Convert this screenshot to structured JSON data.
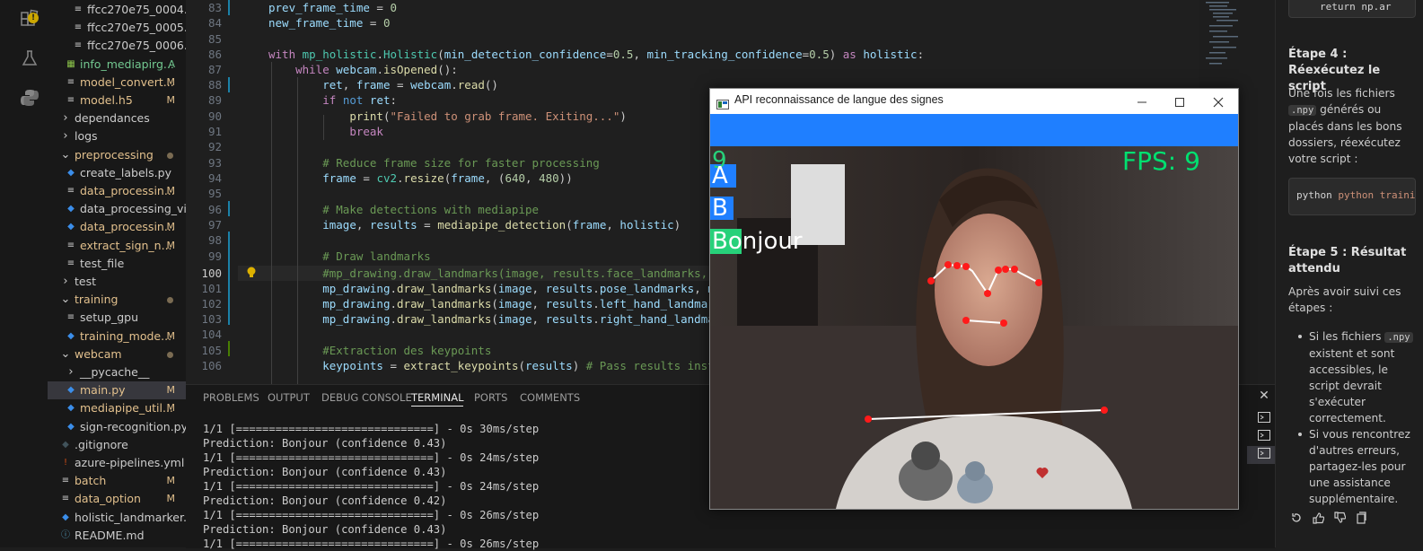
{
  "activity_bar": {
    "icons": [
      "extensions-icon",
      "flask-icon",
      "python-icon"
    ],
    "warning_badge": "!"
  },
  "explorer": {
    "rows": [
      {
        "label": "ffcc270e75_0004.n...",
        "status": "",
        "icon": "file-lines-icon",
        "indent": 2
      },
      {
        "label": "ffcc270e75_0005.n...",
        "status": "",
        "icon": "file-lines-icon",
        "indent": 2
      },
      {
        "label": "ffcc270e75_0006.n...",
        "status": "",
        "icon": "file-lines-icon",
        "indent": 2
      },
      {
        "label": "info_mediapirg...",
        "status": "A",
        "icon": "table-icon",
        "indent": 1
      },
      {
        "label": "model_convert...",
        "status": "M",
        "icon": "file-lines-icon",
        "indent": 1
      },
      {
        "label": "model.h5",
        "status": "M",
        "icon": "file-lines-icon",
        "indent": 1
      },
      {
        "label": "dependances",
        "status": "",
        "icon": "chevron-right-icon",
        "indent": 0
      },
      {
        "label": "logs",
        "status": "",
        "icon": "chevron-right-icon",
        "indent": 0
      },
      {
        "label": "preprocessing",
        "status": "dot",
        "icon": "chevron-down-icon",
        "indent": 0
      },
      {
        "label": "create_labels.py",
        "status": "",
        "icon": "python-file-icon",
        "indent": 1
      },
      {
        "label": "data_processin...",
        "status": "M",
        "icon": "file-lines-icon",
        "indent": 1
      },
      {
        "label": "data_processing_vid...",
        "status": "",
        "icon": "python-file-icon",
        "indent": 1
      },
      {
        "label": "data_processin...",
        "status": "M",
        "icon": "python-file-icon",
        "indent": 1
      },
      {
        "label": "extract_sign_n...",
        "status": "M",
        "icon": "file-lines-icon",
        "indent": 1
      },
      {
        "label": "test_file",
        "status": "",
        "icon": "file-lines-icon",
        "indent": 1
      },
      {
        "label": "test",
        "status": "",
        "icon": "chevron-right-icon",
        "indent": 0
      },
      {
        "label": "training",
        "status": "dot",
        "icon": "chevron-down-icon",
        "indent": 0
      },
      {
        "label": "setup_gpu",
        "status": "",
        "icon": "file-lines-icon",
        "indent": 1
      },
      {
        "label": "training_mode...",
        "status": "M",
        "icon": "python-file-icon",
        "indent": 1
      },
      {
        "label": "webcam",
        "status": "dot",
        "icon": "chevron-down-icon",
        "indent": 0
      },
      {
        "label": "__pycache__",
        "status": "",
        "icon": "chevron-right-icon",
        "indent": 1
      },
      {
        "label": "main.py",
        "status": "M",
        "icon": "python-file-icon",
        "indent": 1
      },
      {
        "label": "mediapipe_util...",
        "status": "M",
        "icon": "python-file-icon",
        "indent": 1
      },
      {
        "label": "sign-recognition.py",
        "status": "",
        "icon": "python-file-icon",
        "indent": 1
      },
      {
        "label": ".gitignore",
        "status": "",
        "icon": "git-icon",
        "indent": 0
      },
      {
        "label": "azure-pipelines.yml",
        "status": "",
        "icon": "exclamation-icon",
        "indent": 0
      },
      {
        "label": "batch",
        "status": "M",
        "icon": "file-lines-icon",
        "indent": 0
      },
      {
        "label": "data_option",
        "status": "M",
        "icon": "file-lines-icon",
        "indent": 0
      },
      {
        "label": "holistic_landmarker.py",
        "status": "",
        "icon": "python-file-icon",
        "indent": 0
      },
      {
        "label": "README.md",
        "status": "",
        "icon": "info-icon",
        "indent": 0
      }
    ]
  },
  "editor": {
    "line_numbers": [
      "83",
      "84",
      "85",
      "86",
      "87",
      "88",
      "89",
      "90",
      "91",
      "92",
      "93",
      "94",
      "95",
      "96",
      "97",
      "98",
      "99",
      "100",
      "101",
      "102",
      "103",
      "104",
      "105",
      "106"
    ],
    "current_line": "100"
  },
  "panel": {
    "tabs": [
      "PROBLEMS",
      "OUTPUT",
      "DEBUG CONSOLE",
      "TERMINAL",
      "PORTS",
      "COMMENTS"
    ],
    "active_tab": "TERMINAL",
    "terminal_lines": [
      "1/1 [==============================] - 0s 30ms/step",
      "Prediction: Bonjour (confidence 0.43)",
      "1/1 [==============================] - 0s 24ms/step",
      "Prediction: Bonjour (confidence 0.43)",
      "1/1 [==============================] - 0s 24ms/step",
      "Prediction: Bonjour (confidence 0.42)",
      "1/1 [==============================] - 0s 26ms/step",
      "Prediction: Bonjour (confidence 0.43)",
      "1/1 [==============================] - 0s 26ms/step"
    ],
    "close_glyph": "✕"
  },
  "chat": {
    "top_code": "return np.ar",
    "step4_title": "Étape 4 : Réexécutez le script",
    "step4_text_a": "Une fois les fichiers",
    "step4_inline": ".npy",
    "step4_text_b": "générés ou placés dans les bons dossiers, réexécutez votre script :",
    "code": "python training\\",
    "step5_title": "Étape 5 : Résultat attendu",
    "step5_text": "Après avoir suivi ces étapes :",
    "bullet1_a": "Si les fichiers",
    "bullet1_inline": ".npy",
    "bullet1_b": "existent et sont accessibles, le script devrait s'exécuter correctement.",
    "bullet2": "Si vous rencontrez d'autres erreurs, partagez-les pour une assistance supplémentaire."
  },
  "webcam_window": {
    "title": "API reconnaissance de langue des signes",
    "fps_label": "FPS: 9",
    "labels": [
      "A",
      "B",
      "Bonjour"
    ],
    "top_digit": "9",
    "highlight_prefix": "Bo",
    "highlight_rest": "njour",
    "colors": {
      "header_blue": "#1f7fff",
      "fps_green": "#00e070",
      "landmark_red": "#ff1a1a"
    }
  }
}
